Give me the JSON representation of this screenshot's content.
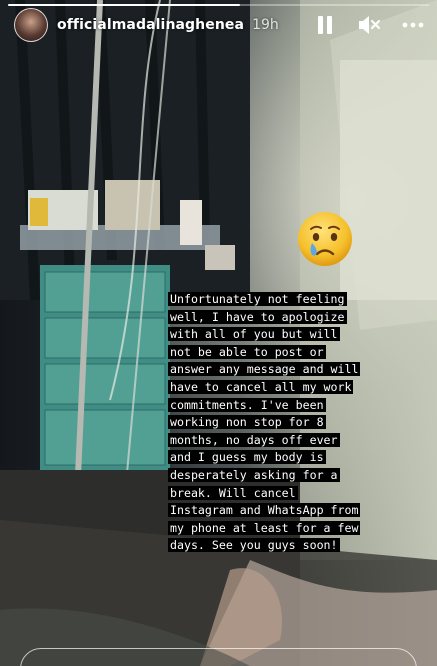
{
  "story": {
    "username": "officialmadalinaghenea",
    "time_ago": "19h",
    "progress": 0.55
  },
  "controls": {
    "pause_icon": "pause-icon",
    "mute_icon": "speaker-muted-icon",
    "more_icon": "more-options-icon"
  },
  "sticker": {
    "emoji": "crying-face"
  },
  "caption": {
    "lines": [
      "Unfortunately not feeling",
      "well, I have to apologize",
      "with all of you but will",
      "not be able to post or",
      "answer any message and will",
      "have to cancel all my work",
      "commitments. I've been",
      "working non stop for 8",
      "months, no days off ever",
      "and I guess my body is",
      "desperately asking for a",
      "break. Will cancel",
      "Instagram and WhatsApp from",
      "my phone at least for a few",
      "days. See you guys soon!"
    ]
  },
  "colors": {
    "caption_bg": "#000000",
    "caption_text": "#ffffff",
    "emoji_yellow": "#f5c02a",
    "tear_blue": "#5aa8e6"
  }
}
